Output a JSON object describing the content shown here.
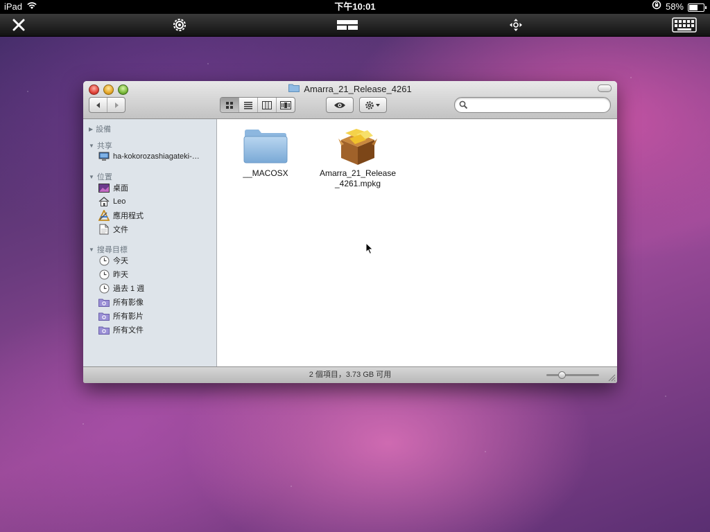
{
  "status_bar": {
    "device": "iPad",
    "time": "下午10:01",
    "battery_text": "58%",
    "battery_level": 0.58
  },
  "toolbar": {
    "icons": [
      "close-icon",
      "gear-icon",
      "window-layout-icon",
      "move-arrows-icon",
      "keyboard-icon"
    ]
  },
  "window": {
    "title": "Amarra_21_Release_4261",
    "search_placeholder": "",
    "view_modes": [
      "icon-view",
      "list-view",
      "column-view",
      "coverflow-view"
    ],
    "active_view": "icon-view"
  },
  "sidebar": {
    "sections": [
      {
        "header": "設備",
        "expanded": false,
        "items": []
      },
      {
        "header": "共享",
        "expanded": true,
        "items": [
          {
            "label": "ha-kokorozashiagateki-…",
            "icon": "computer-icon"
          }
        ]
      },
      {
        "header": "位置",
        "expanded": true,
        "items": [
          {
            "label": "桌面",
            "icon": "desktop-icon"
          },
          {
            "label": "Leo",
            "icon": "home-icon"
          },
          {
            "label": "應用程式",
            "icon": "applications-icon"
          },
          {
            "label": "文件",
            "icon": "documents-icon"
          }
        ]
      },
      {
        "header": "搜尋目標",
        "expanded": true,
        "items": [
          {
            "label": "今天",
            "icon": "clock-icon"
          },
          {
            "label": "昨天",
            "icon": "clock-icon"
          },
          {
            "label": "過去 1 週",
            "icon": "clock-icon"
          },
          {
            "label": "所有影像",
            "icon": "smart-folder-icon"
          },
          {
            "label": "所有影片",
            "icon": "smart-folder-icon"
          },
          {
            "label": "所有文件",
            "icon": "smart-folder-icon"
          }
        ]
      }
    ]
  },
  "files": [
    {
      "name": "__MACOSX",
      "type": "folder"
    },
    {
      "name": "Amarra_21_Release\n_4261.mpkg",
      "line1": "Amarra_21_Release",
      "line2": "_4261.mpkg",
      "type": "package"
    }
  ],
  "footer": {
    "status_text": "2 個項目，3.73 GB 可用",
    "zoom_level": 0.25
  },
  "colors": {
    "sidebar_bg": "#dee4ea",
    "toolbar_bg": "#1a1a1a"
  }
}
